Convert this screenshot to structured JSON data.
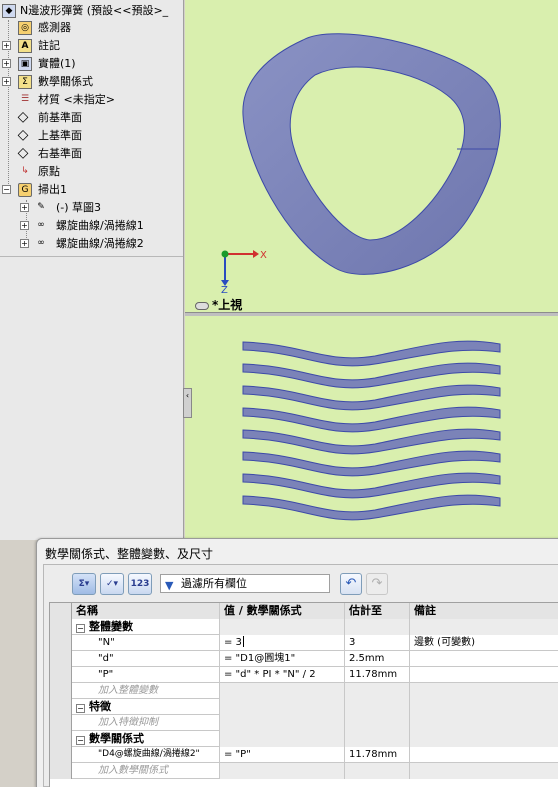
{
  "tree": {
    "root": "N邊波形彈簧 (預設<<預設>_",
    "items": [
      {
        "label": "感測器",
        "icon": "sensor-icon"
      },
      {
        "label": "註記",
        "icon": "annotations-icon",
        "expandable": true
      },
      {
        "label": "實體(1)",
        "icon": "solid-bodies-icon",
        "expandable": true
      },
      {
        "label": "數學關係式",
        "icon": "equations-icon",
        "expandable": true
      },
      {
        "label": "材質 <未指定>",
        "icon": "material-icon"
      },
      {
        "label": "前基準面",
        "icon": "plane-icon"
      },
      {
        "label": "上基準面",
        "icon": "plane-icon"
      },
      {
        "label": "右基準面",
        "icon": "plane-icon"
      },
      {
        "label": "原點",
        "icon": "origin-icon"
      },
      {
        "label": "掃出1",
        "icon": "sweep-icon",
        "expandable": true
      },
      {
        "label": "(-) 草圖3",
        "icon": "sketch-icon",
        "expandable": true,
        "child": true
      },
      {
        "label": "螺旋曲線/渦捲線1",
        "icon": "helix-icon",
        "expandable": true,
        "child": true
      },
      {
        "label": "螺旋曲線/渦捲線2",
        "icon": "helix-icon",
        "expandable": true,
        "child": true
      }
    ]
  },
  "viewport": {
    "view_name": "*上視",
    "axis_x": "X",
    "axis_z": "Z",
    "colors": {
      "background": "#d9efae",
      "model": "#7b83b8",
      "model_edge": "#3d4aa8"
    }
  },
  "dialog": {
    "title": "數學關係式、整體變數、及尺寸",
    "filter_placeholder": "過濾所有欄位",
    "columns": [
      "名稱",
      "值 / 數學關係式",
      "估計至",
      "備註"
    ],
    "sections": [
      {
        "title": "整體變數",
        "rows": [
          {
            "name": "\"N\"",
            "value": "= 3",
            "eval": "3",
            "comment": "邊數 (可變數)"
          },
          {
            "name": "\"d\"",
            "value": "= \"D1@圓塊1\"",
            "eval": "2.5mm",
            "comment": ""
          },
          {
            "name": "\"P\"",
            "value": "= \"d\" * PI * \"N\" / 2",
            "eval": "11.78mm",
            "comment": ""
          }
        ],
        "add_label": "加入整體變數"
      },
      {
        "title": "特徵",
        "rows": [],
        "add_label": "加入特徵抑制"
      },
      {
        "title": "數學關係式",
        "rows": [
          {
            "name": "\"D4@螺旋曲線/渦捲線2\"",
            "value": "= \"P\"",
            "eval": "11.78mm",
            "comment": ""
          }
        ],
        "add_label": "加入數學關係式"
      }
    ]
  }
}
